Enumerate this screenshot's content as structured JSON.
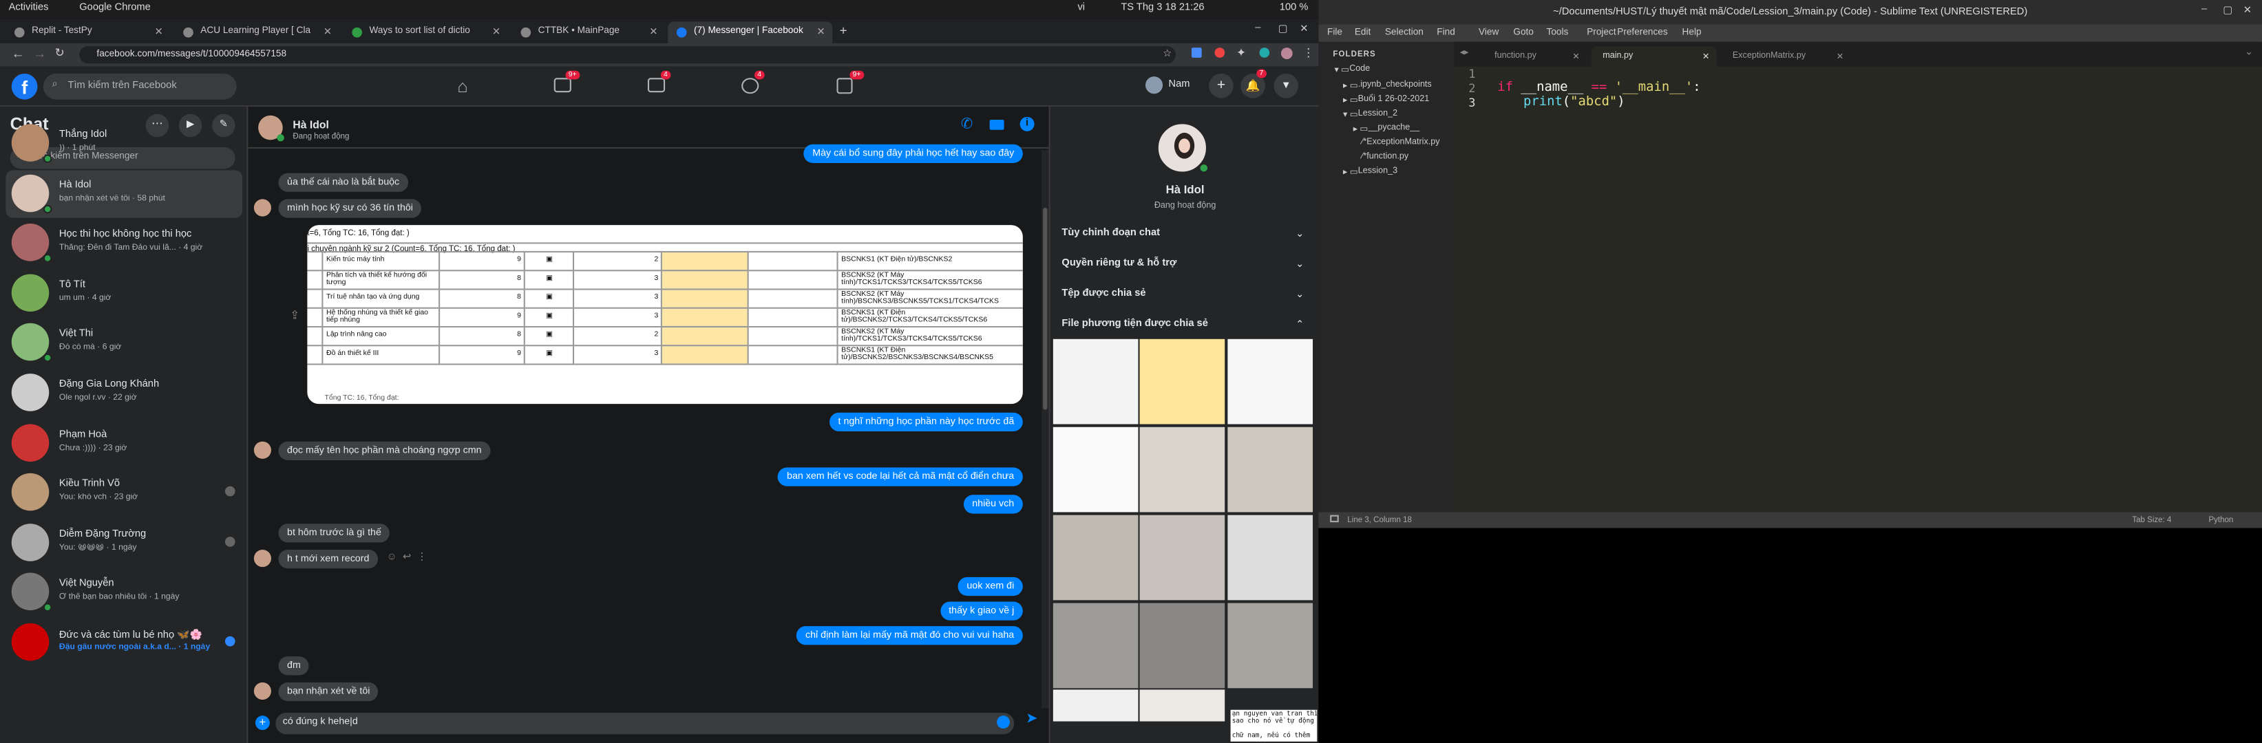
{
  "system": {
    "activities": "Activities",
    "app": "Google Chrome",
    "lang": "vi",
    "clock": "TS Thg 3 18  21:26",
    "battery": "100 %"
  },
  "chrome": {
    "tabs": [
      {
        "label": "Replit - TestPy"
      },
      {
        "label": "ACU Learning Player [ Cla"
      },
      {
        "label": "Ways to sort list of dictio"
      },
      {
        "label": "CTTBK • MainPage"
      },
      {
        "label": "(7) Messenger | Facebook"
      }
    ],
    "url": "facebook.com/messages/t/100009464557158"
  },
  "fb": {
    "search_placeholder": "Tìm kiếm trên Facebook",
    "badges": {
      "watch": "9+",
      "market": "4",
      "groups": "4",
      "gaming": "9+",
      "notif": "7"
    },
    "user": "Nam"
  },
  "chat": {
    "title": "Chat",
    "search_placeholder": "Tìm kiếm trên Messenger",
    "conversations": [
      {
        "name": "Thắng Idol",
        "preview": ")) · 1 phút"
      },
      {
        "name": "Hà Idol",
        "preview": "bạn nhận xét về tôi · 58 phút"
      },
      {
        "name": "Học thi học không học thi học",
        "preview": "Thắng: Đến đi Tam Đảo vui lắ... · 4 giờ"
      },
      {
        "name": "Tô Tít",
        "preview": "um um · 4 giờ"
      },
      {
        "name": "Việt Thi",
        "preview": "Đó có mà · 6 giờ"
      },
      {
        "name": "Đặng Gia Long Khánh",
        "preview": "Ole ngol r.vv · 22 giờ"
      },
      {
        "name": "Phạm Hoà",
        "preview": "Chưa :)))) · 23 giờ"
      },
      {
        "name": "Kiều Trinh Võ",
        "preview": "You: khó vch · 23 giờ"
      },
      {
        "name": "Diễm Đặng Trường",
        "preview": "You: 😆😆😆 · 1 ngày"
      },
      {
        "name": "Việt Nguyễn",
        "preview": "Ơ thế bạn bao nhiêu tôi · 1 ngày"
      },
      {
        "name": "Đức và các tùm lu bé nhọ 🦋🌸",
        "preview": "Đậu gấu nước ngoài a.k.a d... · 1 ngày"
      }
    ]
  },
  "conversation": {
    "name": "Hà Idol",
    "status": "Đang hoạt động",
    "messages": [
      {
        "dir": "out",
        "text": "Mày cái bổ sung đây phải học hết hay sao đây"
      },
      {
        "dir": "in",
        "text": "ủa thế cái nào là bắt buộc"
      },
      {
        "dir": "in",
        "text": "mình học kỹ sư có 36 tín thôi"
      },
      {
        "dir": "out",
        "text": "t nghĩ những học phần này học trước đã"
      },
      {
        "dir": "in",
        "text": "đọc mấy tên học phần mà choáng ngợp cmn"
      },
      {
        "dir": "out",
        "text": "ban xem hết vs code lại hết cả mã mật cổ điển chưa"
      },
      {
        "dir": "out",
        "text": "nhiều vch"
      },
      {
        "dir": "in",
        "text": "bt hôm trước là gì thế"
      },
      {
        "dir": "in",
        "text": "h t mới xem record"
      },
      {
        "dir": "out",
        "text": "uok xem đi"
      },
      {
        "dir": "out",
        "text": "thấy k giao về j"
      },
      {
        "dir": "out",
        "text": "chỉ định làm lại mấy mã mật đó cho vui vui haha"
      },
      {
        "dir": "in",
        "text": "đm"
      },
      {
        "dir": "in",
        "text": "bạn nhận  xét về tôi"
      }
    ],
    "composer_value": "có đúng k hehe|d",
    "table_image": {
      "caption1": "t=6, Tổng TC: 16, Tổng đạt: )",
      "caption2": "i chuyên ngành kỹ sư 2 (Count=6, Tổng TC: 16, Tổng đạt: )",
      "footer": "Tổng TC: 16, Tổng đạt: ",
      "rows": [
        {
          "name": "Kiến trúc máy tính",
          "n": "9",
          "c": "2",
          "code": "BSCNKS1 (KT Điện tử)/BSCNKS2"
        },
        {
          "name": "Phân tích và thiết kế hướng đối tượng",
          "n": "8",
          "c": "3",
          "code": "BSCNKS2 (KT Máy tính)/TCKS1/TCKS3/TCKS4/TCKS5/TCKS6"
        },
        {
          "name": "Trí tuệ nhân tạo và ứng dụng",
          "n": "8",
          "c": "3",
          "code": "BSCNKS2 (KT Máy tính)/BSCNKS3/BSCNKS5/TCKS1/TCKS4/TCKS"
        },
        {
          "name": "Hệ thống nhúng và thiết kế giao tiếp nhúng",
          "n": "9",
          "c": "3",
          "code": "BSCNKS1 (KT Điện tử)/BSCNKS2/TCKS3/TCKS4/TCKS5/TCKS6"
        },
        {
          "name": "Lập trình nâng cao",
          "n": "8",
          "c": "2",
          "code": "BSCNKS2 (KT Máy tính)/TCKS1/TCKS3/TCKS4/TCKS5/TCKS6"
        },
        {
          "name": "Đồ án thiết kế III",
          "n": "9",
          "c": "3",
          "code": "BSCNKS1 (KT Điện tử)/BSCNKS2/BSCNKS3/BSCNKS4/BSCNKS5"
        }
      ]
    }
  },
  "info": {
    "name": "Hà Idol",
    "status": "Đang hoạt động",
    "sections": [
      "Tùy chỉnh đoạn chat",
      "Quyền riêng tư & hỗ trợ",
      "Tệp được chia sẻ",
      "File phương tiện được chia sẻ"
    ],
    "partial_text": "ạn nguyen van tran thì\nsao cho nó về tự động\n\nchữ nam, nếu có thêm"
  },
  "sublime": {
    "title": "~/Documents/HUST/Lý thuyết mật mã/Code/Lession_3/main.py (Code) - Sublime Text (UNREGISTERED)",
    "menu": [
      "File",
      "Edit",
      "Selection",
      "Find",
      "View",
      "Goto",
      "Tools",
      "Project",
      "Preferences",
      "Help"
    ],
    "tabs": [
      "function.py",
      "main.py",
      "ExceptionMatrix.py"
    ],
    "folders_label": "FOLDERS",
    "tree": [
      "Code",
      ".ipynb_checkpoints",
      "Buổi 1 26-02-2021",
      "Lession_2",
      "__pycache__",
      "ExceptionMatrix.py",
      "function.py",
      "Lession_3"
    ],
    "lines": [
      "1",
      "2",
      "3"
    ],
    "code_line2": [
      "if",
      "__name__",
      "==",
      "'__main__'",
      ":"
    ],
    "code_line3": [
      "print",
      "(",
      "\"abcd\"",
      ")"
    ],
    "status_left": "Line 3, Column 18",
    "tab_size": "Tab Size: 4",
    "syntax": "Python"
  }
}
